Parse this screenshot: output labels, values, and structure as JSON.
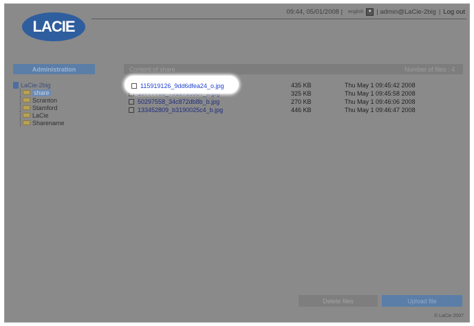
{
  "header": {
    "logo": "LACIE",
    "datetime": "09:44, 05/01/2008 |",
    "language": "english",
    "user": "| admin@LaCie-2big",
    "separator": "|",
    "logout": "Log out"
  },
  "sidebar": {
    "title": "Administration",
    "root": "LaCie-2big",
    "items": [
      {
        "label": "share",
        "selected": true
      },
      {
        "label": "Scranton",
        "selected": false
      },
      {
        "label": "Stamford",
        "selected": false
      },
      {
        "label": "LaCie",
        "selected": false
      },
      {
        "label": "Sharename",
        "selected": false
      }
    ]
  },
  "content": {
    "title": "Content of share",
    "count_label": "Number of files : 4",
    "files": [
      {
        "name": "115919126_9dd6dfea24_o.jpg",
        "size": "435 KB",
        "date": "Thu May 1 09:45:42 2008"
      },
      {
        "name": "10777706_791e795987_b.jpg",
        "size": "325 KB",
        "date": "Thu May 1 09:45:58 2008"
      },
      {
        "name": "50297558_34c872db8b_b.jpg",
        "size": "270 KB",
        "date": "Thu May 1 09:46:06 2008"
      },
      {
        "name": "133452809_b3190025c4_b.jpg",
        "size": "446 KB",
        "date": "Thu May 1 09:46:47 2008"
      }
    ]
  },
  "buttons": {
    "delete": "Delete files",
    "upload": "Upload file"
  },
  "footer": {
    "copyright": "© LaCie 2007"
  },
  "colors": {
    "accent": "#5b7ea8",
    "dim_overlay": "#8a8a8a",
    "link_highlight": "#1e3fd1"
  }
}
